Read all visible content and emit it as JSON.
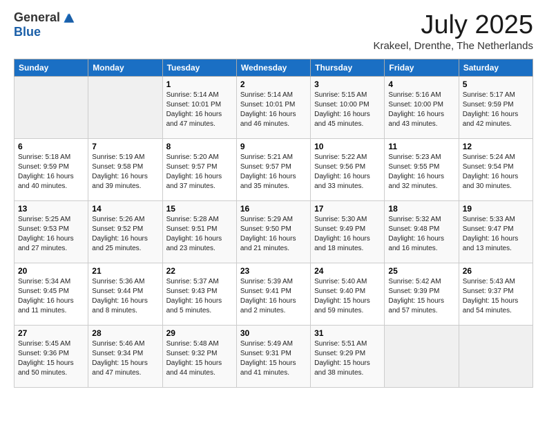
{
  "logo": {
    "general": "General",
    "blue": "Blue"
  },
  "header": {
    "month": "July 2025",
    "location": "Krakeel, Drenthe, The Netherlands"
  },
  "weekdays": [
    "Sunday",
    "Monday",
    "Tuesday",
    "Wednesday",
    "Thursday",
    "Friday",
    "Saturday"
  ],
  "weeks": [
    [
      {
        "day": "",
        "empty": true
      },
      {
        "day": "",
        "empty": true
      },
      {
        "day": "1",
        "sunrise": "5:14 AM",
        "sunset": "10:01 PM",
        "daylight": "16 hours and 47 minutes."
      },
      {
        "day": "2",
        "sunrise": "5:14 AM",
        "sunset": "10:01 PM",
        "daylight": "16 hours and 46 minutes."
      },
      {
        "day": "3",
        "sunrise": "5:15 AM",
        "sunset": "10:00 PM",
        "daylight": "16 hours and 45 minutes."
      },
      {
        "day": "4",
        "sunrise": "5:16 AM",
        "sunset": "10:00 PM",
        "daylight": "16 hours and 43 minutes."
      },
      {
        "day": "5",
        "sunrise": "5:17 AM",
        "sunset": "9:59 PM",
        "daylight": "16 hours and 42 minutes."
      }
    ],
    [
      {
        "day": "6",
        "sunrise": "5:18 AM",
        "sunset": "9:59 PM",
        "daylight": "16 hours and 40 minutes."
      },
      {
        "day": "7",
        "sunrise": "5:19 AM",
        "sunset": "9:58 PM",
        "daylight": "16 hours and 39 minutes."
      },
      {
        "day": "8",
        "sunrise": "5:20 AM",
        "sunset": "9:57 PM",
        "daylight": "16 hours and 37 minutes."
      },
      {
        "day": "9",
        "sunrise": "5:21 AM",
        "sunset": "9:57 PM",
        "daylight": "16 hours and 35 minutes."
      },
      {
        "day": "10",
        "sunrise": "5:22 AM",
        "sunset": "9:56 PM",
        "daylight": "16 hours and 33 minutes."
      },
      {
        "day": "11",
        "sunrise": "5:23 AM",
        "sunset": "9:55 PM",
        "daylight": "16 hours and 32 minutes."
      },
      {
        "day": "12",
        "sunrise": "5:24 AM",
        "sunset": "9:54 PM",
        "daylight": "16 hours and 30 minutes."
      }
    ],
    [
      {
        "day": "13",
        "sunrise": "5:25 AM",
        "sunset": "9:53 PM",
        "daylight": "16 hours and 27 minutes."
      },
      {
        "day": "14",
        "sunrise": "5:26 AM",
        "sunset": "9:52 PM",
        "daylight": "16 hours and 25 minutes."
      },
      {
        "day": "15",
        "sunrise": "5:28 AM",
        "sunset": "9:51 PM",
        "daylight": "16 hours and 23 minutes."
      },
      {
        "day": "16",
        "sunrise": "5:29 AM",
        "sunset": "9:50 PM",
        "daylight": "16 hours and 21 minutes."
      },
      {
        "day": "17",
        "sunrise": "5:30 AM",
        "sunset": "9:49 PM",
        "daylight": "16 hours and 18 minutes."
      },
      {
        "day": "18",
        "sunrise": "5:32 AM",
        "sunset": "9:48 PM",
        "daylight": "16 hours and 16 minutes."
      },
      {
        "day": "19",
        "sunrise": "5:33 AM",
        "sunset": "9:47 PM",
        "daylight": "16 hours and 13 minutes."
      }
    ],
    [
      {
        "day": "20",
        "sunrise": "5:34 AM",
        "sunset": "9:45 PM",
        "daylight": "16 hours and 11 minutes."
      },
      {
        "day": "21",
        "sunrise": "5:36 AM",
        "sunset": "9:44 PM",
        "daylight": "16 hours and 8 minutes."
      },
      {
        "day": "22",
        "sunrise": "5:37 AM",
        "sunset": "9:43 PM",
        "daylight": "16 hours and 5 minutes."
      },
      {
        "day": "23",
        "sunrise": "5:39 AM",
        "sunset": "9:41 PM",
        "daylight": "16 hours and 2 minutes."
      },
      {
        "day": "24",
        "sunrise": "5:40 AM",
        "sunset": "9:40 PM",
        "daylight": "15 hours and 59 minutes."
      },
      {
        "day": "25",
        "sunrise": "5:42 AM",
        "sunset": "9:39 PM",
        "daylight": "15 hours and 57 minutes."
      },
      {
        "day": "26",
        "sunrise": "5:43 AM",
        "sunset": "9:37 PM",
        "daylight": "15 hours and 54 minutes."
      }
    ],
    [
      {
        "day": "27",
        "sunrise": "5:45 AM",
        "sunset": "9:36 PM",
        "daylight": "15 hours and 50 minutes."
      },
      {
        "day": "28",
        "sunrise": "5:46 AM",
        "sunset": "9:34 PM",
        "daylight": "15 hours and 47 minutes."
      },
      {
        "day": "29",
        "sunrise": "5:48 AM",
        "sunset": "9:32 PM",
        "daylight": "15 hours and 44 minutes."
      },
      {
        "day": "30",
        "sunrise": "5:49 AM",
        "sunset": "9:31 PM",
        "daylight": "15 hours and 41 minutes."
      },
      {
        "day": "31",
        "sunrise": "5:51 AM",
        "sunset": "9:29 PM",
        "daylight": "15 hours and 38 minutes."
      },
      {
        "day": "",
        "empty": true
      },
      {
        "day": "",
        "empty": true
      }
    ]
  ]
}
